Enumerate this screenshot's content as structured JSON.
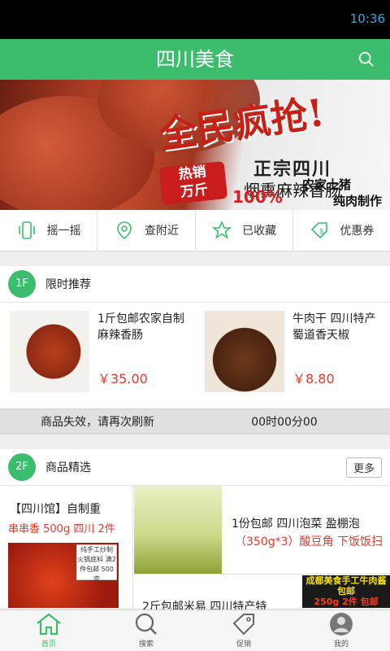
{
  "status": {
    "time": "10:36"
  },
  "header": {
    "title": "四川美食"
  },
  "banner": {
    "slogan": "全民疯抢!",
    "line1": "正宗四川",
    "line2": "烟熏麻辣香肠",
    "hot": "热销\n万斤",
    "percent": "100%",
    "farm": "农家土猪",
    "pure": "纯肉制作"
  },
  "quicknav": [
    {
      "label": "摇一摇",
      "icon": "phone-shake-icon"
    },
    {
      "label": "查附近",
      "icon": "location-pin-icon"
    },
    {
      "label": "已收藏",
      "icon": "star-icon"
    },
    {
      "label": "优惠券",
      "icon": "coupon-icon"
    }
  ],
  "section1": {
    "floor": "1F",
    "title": "限时推荐",
    "products": [
      {
        "name": "1斤包邮农家自制麻辣香肠",
        "price": "￥35.00"
      },
      {
        "name": "牛肉干 四川特产蜀道香天椒",
        "price": "￥8.80"
      }
    ],
    "expire_msg": "商品失效，请再次刷新",
    "timer": "00时00分00"
  },
  "section2": {
    "floor": "2F",
    "title": "商品精选",
    "more": "更多",
    "left": {
      "title": "【四川馆】自制重",
      "subtitle": "串串香 500g 四川 2件",
      "badge": "纯手工炒制 火锅底料 满2件包邮 500克"
    },
    "right_top": {
      "title": "1份包邮 四川泡菜 盈棚泡",
      "subtitle": "（350g*3）酸豆角 下饭饭扫"
    },
    "right_bottom": {
      "title": "2斤包邮米易 四川特产特",
      "banner_a": "成都美食手工牛肉酱包邮",
      "banner_b": "250g 2件 包邮"
    }
  },
  "tabbar": [
    {
      "label": "首页",
      "icon": "home-icon",
      "active": true
    },
    {
      "label": "搜索",
      "icon": "search-icon",
      "active": false
    },
    {
      "label": "促销",
      "icon": "tag-icon",
      "active": false
    },
    {
      "label": "我的",
      "icon": "user-icon",
      "active": false
    }
  ],
  "colors": {
    "brand": "#3cbd6e",
    "price": "#e23a2b",
    "status_time": "#2fa7e6"
  }
}
